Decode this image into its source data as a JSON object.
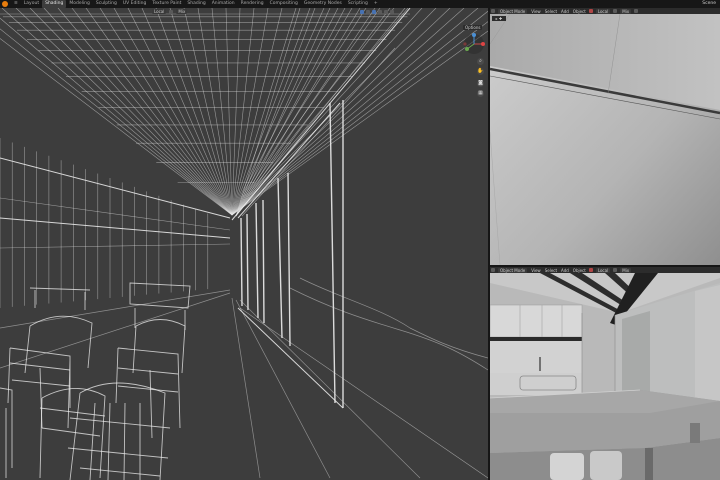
{
  "app": {
    "scene": "Scene"
  },
  "workspace_tabs": [
    "Layout",
    "Shading",
    "Modeling",
    "Sculpting",
    "UV Editing",
    "Texture Paint",
    "Shading",
    "Animation",
    "Rendering",
    "Compositing",
    "Geometry Nodes",
    "Scripting"
  ],
  "active_tab_index": 1,
  "main_view": {
    "header": {
      "pivot": "Local",
      "snap": "Mix"
    },
    "options_label": "Options"
  },
  "top_right_view": {
    "header": {
      "mode": "Object Mode",
      "menus": [
        "View",
        "Select",
        "Add",
        "Object"
      ],
      "pivot": "Local",
      "snap": "Mix"
    }
  },
  "bottom_right_view": {
    "header": {
      "mode": "Object Mode",
      "menus": [
        "View",
        "Select",
        "Add",
        "Object"
      ],
      "pivot": "Local",
      "snap": "Mix"
    }
  },
  "colors": {
    "accent": "#4772b3",
    "background": "#3d3d3d",
    "wire": "#e8e8e8",
    "logo": "#e87d0d"
  },
  "icons": {
    "logo": "blender-logo",
    "gizmo": "navigation-gizmo",
    "zoom": "zoom-icon",
    "pan": "hand-icon",
    "camera": "camera-icon",
    "grid": "grid-icon"
  }
}
